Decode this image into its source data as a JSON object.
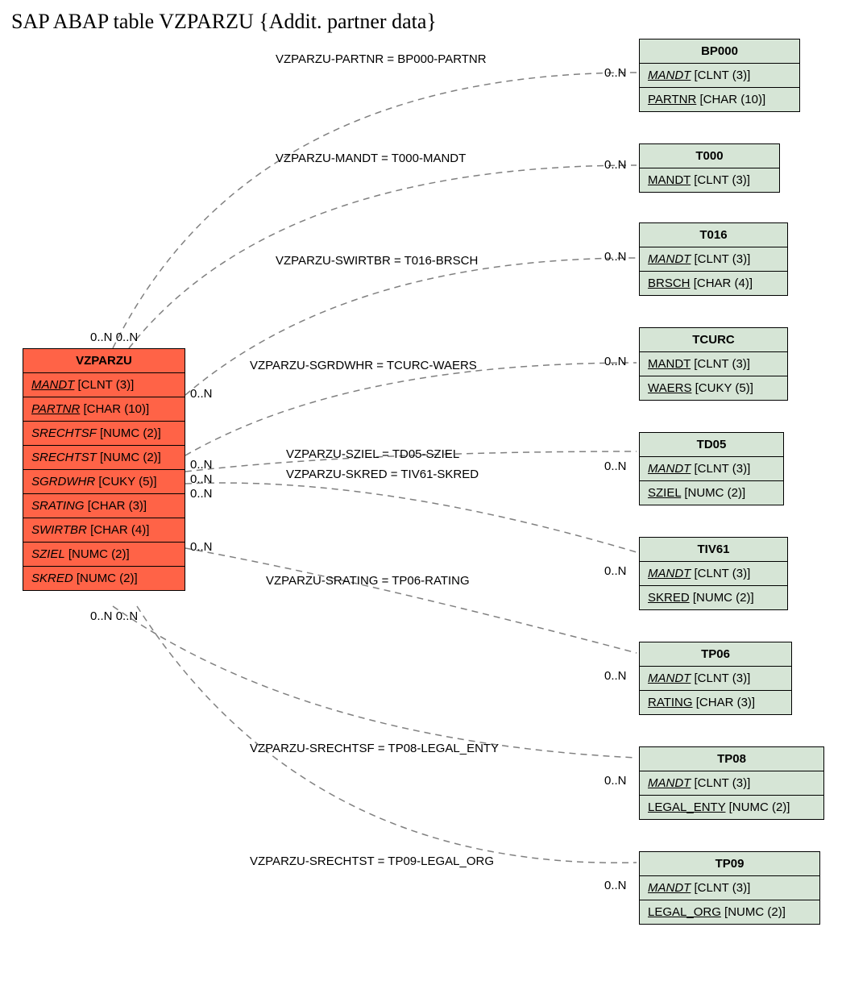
{
  "title": "SAP ABAP table VZPARZU {Addit. partner data}",
  "main_entity": {
    "name": "VZPARZU",
    "fields": [
      {
        "name": "MANDT",
        "type": "[CLNT (3)]",
        "style": "fk"
      },
      {
        "name": "PARTNR",
        "type": "[CHAR (10)]",
        "style": "fk"
      },
      {
        "name": "SRECHTSF",
        "type": "[NUMC (2)]",
        "style": "it"
      },
      {
        "name": "SRECHTST",
        "type": "[NUMC (2)]",
        "style": "it"
      },
      {
        "name": "SGRDWHR",
        "type": "[CUKY (5)]",
        "style": "it"
      },
      {
        "name": "SRATING",
        "type": "[CHAR (3)]",
        "style": "it"
      },
      {
        "name": "SWIRTBR",
        "type": "[CHAR (4)]",
        "style": "it"
      },
      {
        "name": "SZIEL",
        "type": "[NUMC (2)]",
        "style": "it"
      },
      {
        "name": "SKRED",
        "type": "[NUMC (2)]",
        "style": "it"
      }
    ]
  },
  "ref_entities": [
    {
      "name": "BP000",
      "fields": [
        {
          "name": "MANDT",
          "type": "[CLNT (3)]",
          "style": "fk"
        },
        {
          "name": "PARTNR",
          "type": "[CHAR (10)]",
          "style": "pk"
        }
      ]
    },
    {
      "name": "T000",
      "fields": [
        {
          "name": "MANDT",
          "type": "[CLNT (3)]",
          "style": "pk"
        }
      ]
    },
    {
      "name": "T016",
      "fields": [
        {
          "name": "MANDT",
          "type": "[CLNT (3)]",
          "style": "fk"
        },
        {
          "name": "BRSCH",
          "type": "[CHAR (4)]",
          "style": "pk"
        }
      ]
    },
    {
      "name": "TCURC",
      "fields": [
        {
          "name": "MANDT",
          "type": "[CLNT (3)]",
          "style": "pk"
        },
        {
          "name": "WAERS",
          "type": "[CUKY (5)]",
          "style": "pk"
        }
      ]
    },
    {
      "name": "TD05",
      "fields": [
        {
          "name": "MANDT",
          "type": "[CLNT (3)]",
          "style": "fk"
        },
        {
          "name": "SZIEL",
          "type": "[NUMC (2)]",
          "style": "pk"
        }
      ]
    },
    {
      "name": "TIV61",
      "fields": [
        {
          "name": "MANDT",
          "type": "[CLNT (3)]",
          "style": "fk"
        },
        {
          "name": "SKRED",
          "type": "[NUMC (2)]",
          "style": "pk"
        }
      ]
    },
    {
      "name": "TP06",
      "fields": [
        {
          "name": "MANDT",
          "type": "[CLNT (3)]",
          "style": "fk"
        },
        {
          "name": "RATING",
          "type": "[CHAR (3)]",
          "style": "pk"
        }
      ]
    },
    {
      "name": "TP08",
      "fields": [
        {
          "name": "MANDT",
          "type": "[CLNT (3)]",
          "style": "fk"
        },
        {
          "name": "LEGAL_ENTY",
          "type": "[NUMC (2)]",
          "style": "pk"
        }
      ]
    },
    {
      "name": "TP09",
      "fields": [
        {
          "name": "MANDT",
          "type": "[CLNT (3)]",
          "style": "fk"
        },
        {
          "name": "LEGAL_ORG",
          "type": "[NUMC (2)]",
          "style": "pk"
        }
      ]
    }
  ],
  "relations": [
    {
      "label": "VZPARZU-PARTNR = BP000-PARTNR"
    },
    {
      "label": "VZPARZU-MANDT = T000-MANDT"
    },
    {
      "label": "VZPARZU-SWIRTBR = T016-BRSCH"
    },
    {
      "label": "VZPARZU-SGRDWHR = TCURC-WAERS"
    },
    {
      "label": "VZPARZU-SZIEL = TD05-SZIEL"
    },
    {
      "label": "VZPARZU-SKRED = TIV61-SKRED"
    },
    {
      "label": "VZPARZU-SRATING = TP06-RATING"
    },
    {
      "label": "VZPARZU-SRECHTSF = TP08-LEGAL_ENTY"
    },
    {
      "label": "VZPARZU-SRECHTST = TP09-LEGAL_ORG"
    }
  ],
  "cardinality": "0..N",
  "chart_data": {
    "type": "entity-relationship",
    "main": "VZPARZU",
    "references": [
      "BP000",
      "T000",
      "T016",
      "TCURC",
      "TD05",
      "TIV61",
      "TP06",
      "TP08",
      "TP09"
    ],
    "joins": [
      {
        "from": "VZPARZU.PARTNR",
        "to": "BP000.PARTNR",
        "card_from": "0..N",
        "card_to": "0..N"
      },
      {
        "from": "VZPARZU.MANDT",
        "to": "T000.MANDT",
        "card_from": "0..N",
        "card_to": "0..N"
      },
      {
        "from": "VZPARZU.SWIRTBR",
        "to": "T016.BRSCH",
        "card_from": "0..N",
        "card_to": "0..N"
      },
      {
        "from": "VZPARZU.SGRDWHR",
        "to": "TCURC.WAERS",
        "card_from": "0..N",
        "card_to": "0..N"
      },
      {
        "from": "VZPARZU.SZIEL",
        "to": "TD05.SZIEL",
        "card_from": "0..N",
        "card_to": "0..N"
      },
      {
        "from": "VZPARZU.SKRED",
        "to": "TIV61.SKRED",
        "card_from": "0..N",
        "card_to": "0..N"
      },
      {
        "from": "VZPARZU.SRATING",
        "to": "TP06.RATING",
        "card_from": "0..N",
        "card_to": "0..N"
      },
      {
        "from": "VZPARZU.SRECHTSF",
        "to": "TP08.LEGAL_ENTY",
        "card_from": "0..N",
        "card_to": "0..N"
      },
      {
        "from": "VZPARZU.SRECHTST",
        "to": "TP09.LEGAL_ORG",
        "card_from": "0..N",
        "card_to": "0..N"
      }
    ]
  }
}
